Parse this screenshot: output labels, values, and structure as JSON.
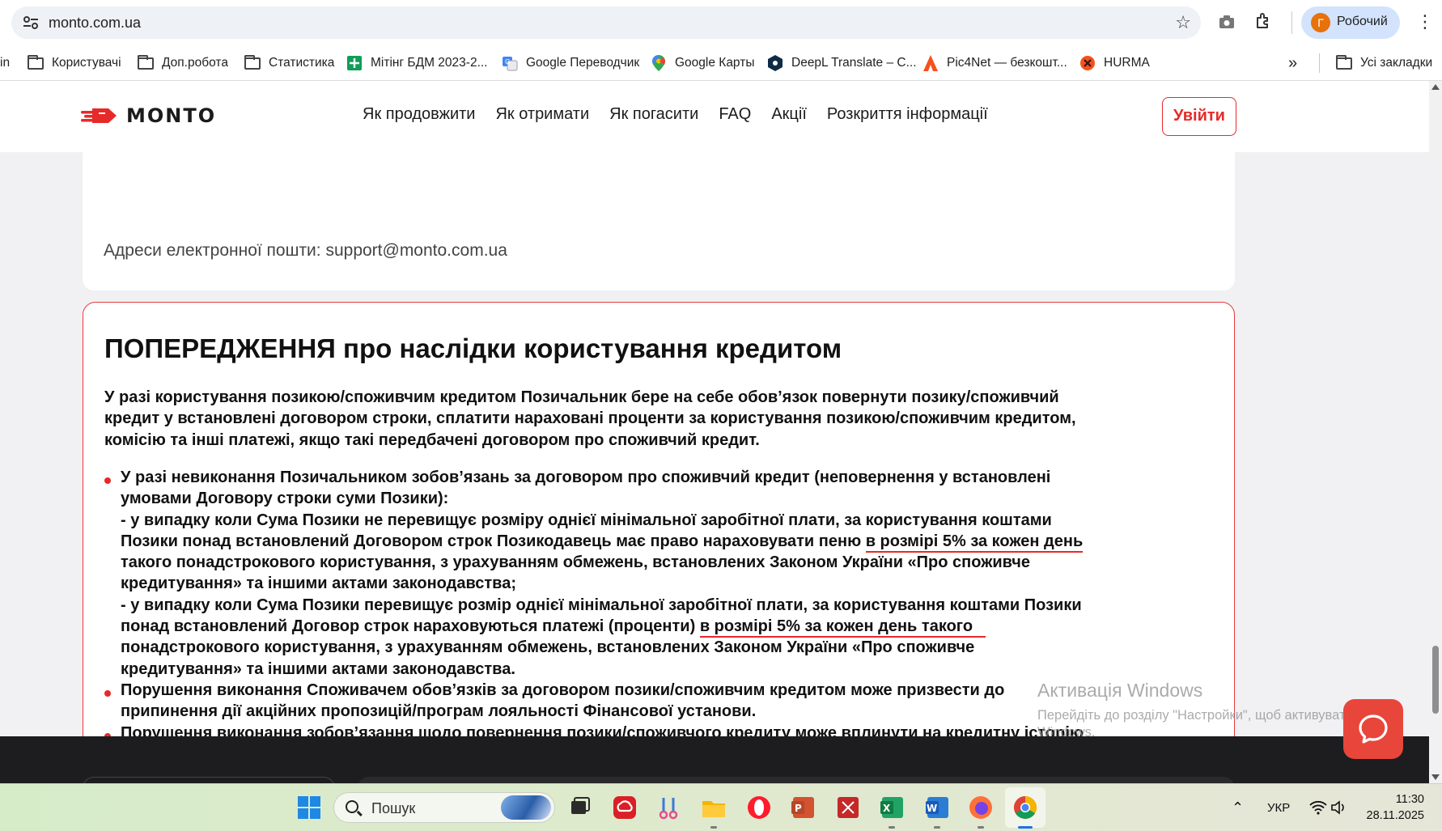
{
  "browser": {
    "url": "monto.com.ua",
    "profile_initial": "Г",
    "profile_label": "Робочий",
    "bookmarks": [
      {
        "label": "in",
        "icon": "partial"
      },
      {
        "label": "Користувачі",
        "icon": "folder-icon"
      },
      {
        "label": "Доп.робота",
        "icon": "folder-icon"
      },
      {
        "label": "Статистика",
        "icon": "folder-icon"
      },
      {
        "label": "Мітінг БДМ 2023-2...",
        "icon": "sheets-icon"
      },
      {
        "label": "Google Переводчик",
        "icon": "translate-icon"
      },
      {
        "label": "Google Карты",
        "icon": "maps-icon"
      },
      {
        "label": "DeepL Translate – С...",
        "icon": "deepl-icon"
      },
      {
        "label": "Pic4Net — безкошт...",
        "icon": "pic4net-icon"
      },
      {
        "label": "HURMA",
        "icon": "hurma-icon"
      }
    ],
    "more_bookmarks": "»",
    "all_bookmarks": "Усі закладки"
  },
  "site": {
    "logo_text": "MONTO",
    "nav": [
      "Як продовжити",
      "Як отримати",
      "Як погасити",
      "FAQ",
      "Акції",
      "Розкриття інформації"
    ],
    "login_label": "Увійти",
    "contact_email_line": "Адреси електронної пошти: support@monto.com.ua",
    "warning": {
      "title": "ПОПЕРЕДЖЕННЯ про наслідки користування кредитом",
      "intro": [
        "У разі користування позикою/споживчим кредитом Позичальник бере на себе обов’язок повернути позику/споживчий",
        "кредит у встановлені договором строки, сплатити нараховані проценти за користування позикою/споживчим кредитом,",
        "комісію та інші платежі, якщо такі передбачені договором про споживчий кредит."
      ],
      "item1": {
        "l1": "У разі невиконання Позичальником зобов’язань за договором про споживчий кредит (неповернення у встановлені",
        "l2": "умовами Договору строки суми Позики):",
        "l3": "- у випадку коли Сума Позики не перевищує розміру однієї мінімальної заробітної плати, за користування коштами",
        "l4a": "Позики понад встановлений Договором строк Позикодавець має право нараховувати пеню ",
        "l4b": "в розмірі 5% за кожен день",
        "l5": "такого понадстрокового користування, з урахуванням обмежень, встановлених Законом України «Про споживче",
        "l6": "кредитування» та іншими актами законодавства;",
        "l7": "- у випадку коли Сума Позики перевищує розмір однієї мінімальної заробітної плати, за користування коштами Позики",
        "l8a": "понад встановлений Договор строк нараховуються платежі (проценти) ",
        "l8b": "в розмірі 5% за кожен день такого",
        "l9": "понадстрокового користування, з урахуванням обмежень, встановлених Законом України «Про споживче",
        "l10": "кредитування» та іншими актами законодавства."
      },
      "item2": {
        "l1": "Порушення виконання Споживачем обов’язків за договором позики/споживчим кредитом може призвести до",
        "l2": "припинення дії акційних пропозицій/програм лояльності Фінансової установи."
      },
      "item3": {
        "l1": "Порушення виконання зобов’язання щодо повернення позики/споживчого кредиту може вплинути на кредитну історію"
      }
    }
  },
  "watermark": {
    "line1": "Активація Windows",
    "line2": "Перейдіть до розділу \"Настройки\", щоб активувати",
    "line3": "Windows."
  },
  "taskbar": {
    "search_placeholder": "Пошук",
    "language": "УКР",
    "time": "11:30",
    "date": "28.11.2025"
  },
  "colors": {
    "brand_red": "#e62a2a",
    "chat_button": "#e8463b",
    "profile_chip": "#d3e3fd"
  }
}
